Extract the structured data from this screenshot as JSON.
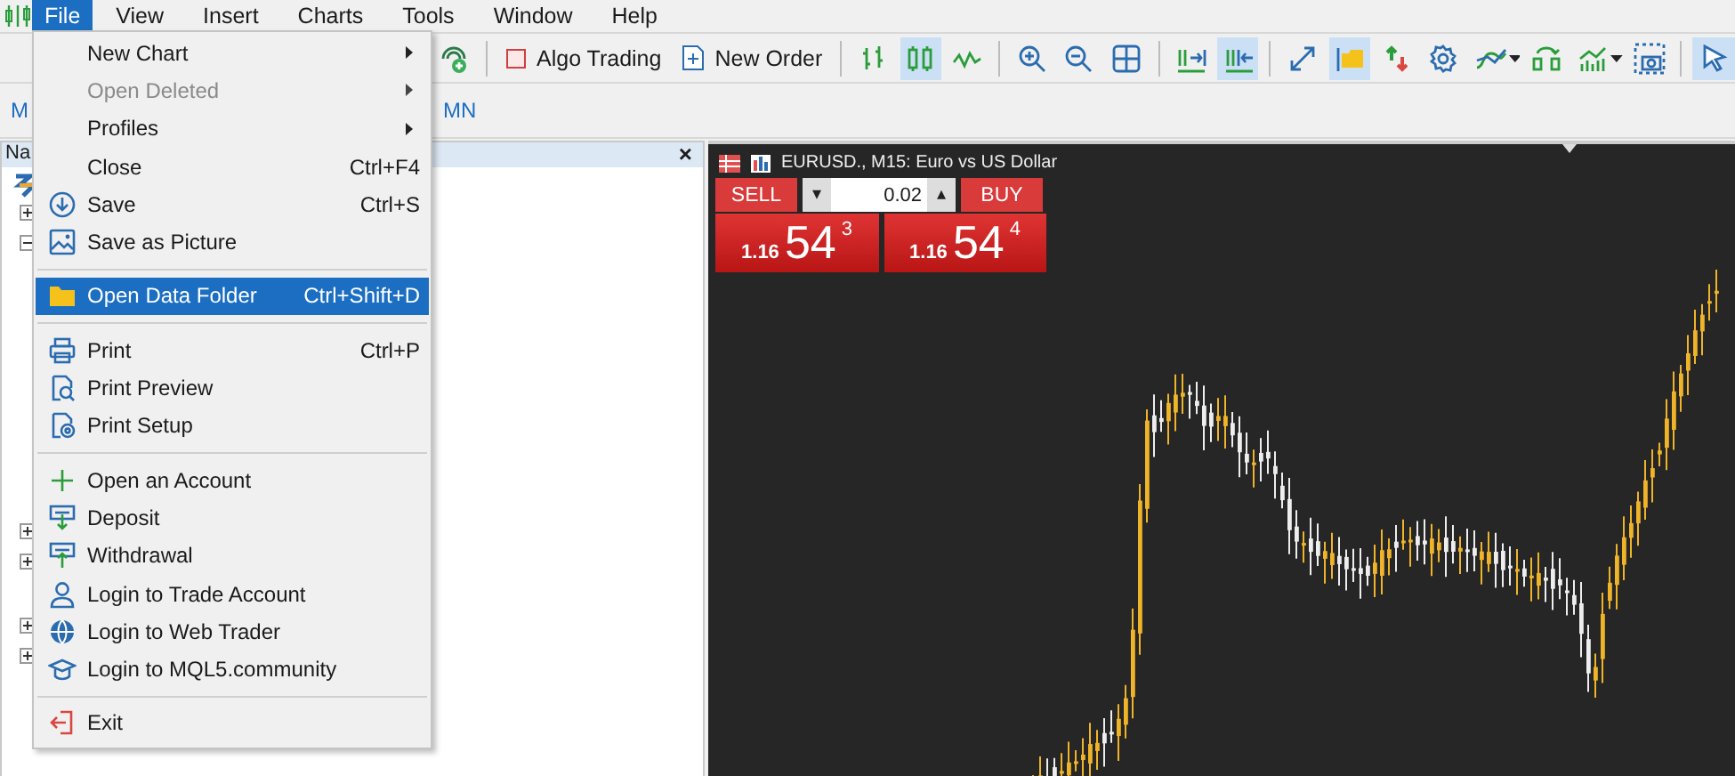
{
  "menubar": [
    {
      "label": "File",
      "selected": true
    },
    {
      "label": "View",
      "selected": false
    },
    {
      "label": "Insert",
      "selected": false
    },
    {
      "label": "Charts",
      "selected": false
    },
    {
      "label": "Tools",
      "selected": false
    },
    {
      "label": "Window",
      "selected": false
    },
    {
      "label": "Help",
      "selected": false
    }
  ],
  "toolbar": [
    {
      "kind": "signal",
      "pressed": false
    },
    {
      "kind": "sep"
    },
    {
      "kind": "algo",
      "label": "Algo Trading",
      "pressed": false
    },
    {
      "kind": "order",
      "label": "New Order",
      "pressed": false
    },
    {
      "kind": "sep"
    },
    {
      "kind": "bars",
      "pressed": false
    },
    {
      "kind": "candles",
      "pressed": true
    },
    {
      "kind": "line",
      "pressed": false
    },
    {
      "kind": "sep"
    },
    {
      "kind": "zoomin",
      "pressed": false
    },
    {
      "kind": "zoomout",
      "pressed": false
    },
    {
      "kind": "grid",
      "pressed": false
    },
    {
      "kind": "sep"
    },
    {
      "kind": "shift",
      "pressed": false
    },
    {
      "kind": "autoscroll",
      "pressed": true
    },
    {
      "kind": "sep"
    },
    {
      "kind": "fullscreen",
      "pressed": false
    },
    {
      "kind": "folder",
      "pressed": true
    },
    {
      "kind": "trade",
      "pressed": false
    },
    {
      "kind": "gear",
      "pressed": false
    },
    {
      "kind": "indicator",
      "pressed": false
    },
    {
      "kind": "caret"
    },
    {
      "kind": "cycle",
      "pressed": false
    },
    {
      "kind": "chart",
      "pressed": false
    },
    {
      "kind": "caret"
    },
    {
      "kind": "camera",
      "pressed": false
    },
    {
      "kind": "sep"
    },
    {
      "kind": "cursor",
      "pressed": true
    }
  ],
  "timeframes": [
    {
      "label": "M"
    },
    {
      "label": "MN"
    }
  ],
  "navigator": {
    "title": "Na",
    "close": "×",
    "nodes": [
      {
        "expanded": false
      },
      {
        "expanded": true
      },
      {
        "expanded": false
      },
      {
        "expanded": false
      },
      {
        "expanded": false
      },
      {
        "expanded": false
      }
    ]
  },
  "file_menu": [
    {
      "kind": "plain",
      "label": "New Chart",
      "submenu": true,
      "disabled": false,
      "selected": false
    },
    {
      "kind": "plain",
      "label": "Open Deleted",
      "submenu": true,
      "disabled": true,
      "selected": false
    },
    {
      "kind": "plain",
      "label": "Profiles",
      "submenu": true,
      "disabled": false,
      "selected": false
    },
    {
      "kind": "plain",
      "label": "Close",
      "shortcut": "Ctrl+F4",
      "disabled": false,
      "selected": false
    },
    {
      "kind": "save",
      "label": "Save",
      "shortcut": "Ctrl+S",
      "disabled": false,
      "selected": false
    },
    {
      "kind": "picture",
      "label": "Save as Picture",
      "disabled": false,
      "selected": false
    },
    {
      "kind": "separator"
    },
    {
      "kind": "folder",
      "label": "Open Data Folder",
      "shortcut": "Ctrl+Shift+D",
      "disabled": false,
      "selected": true
    },
    {
      "kind": "separator"
    },
    {
      "kind": "print",
      "label": "Print",
      "shortcut": "Ctrl+P",
      "disabled": false,
      "selected": false
    },
    {
      "kind": "preview",
      "label": "Print Preview",
      "disabled": false,
      "selected": false
    },
    {
      "kind": "setup",
      "label": "Print Setup",
      "disabled": false,
      "selected": false
    },
    {
      "kind": "separator"
    },
    {
      "kind": "plus",
      "label": "Open an Account",
      "disabled": false,
      "selected": false
    },
    {
      "kind": "deposit",
      "label": "Deposit",
      "disabled": false,
      "selected": false
    },
    {
      "kind": "withdraw",
      "label": "Withdrawal",
      "disabled": false,
      "selected": false
    },
    {
      "kind": "user",
      "label": "Login to Trade Account",
      "disabled": false,
      "selected": false
    },
    {
      "kind": "globe",
      "label": "Login to Web Trader",
      "disabled": false,
      "selected": false
    },
    {
      "kind": "cap",
      "label": "Login to MQL5.community",
      "disabled": false,
      "selected": false
    },
    {
      "kind": "separator"
    },
    {
      "kind": "exit",
      "label": "Exit",
      "disabled": false,
      "selected": false
    }
  ],
  "chart": {
    "title": "EURUSD., M15:  Euro vs US Dollar",
    "trade_panel": {
      "sell_label": "SELL",
      "buy_label": "BUY",
      "volume": "0.02",
      "down": "▾",
      "up": "▴",
      "sell_price": {
        "head": "1.16",
        "big": "54",
        "tail": "3"
      },
      "buy_price": {
        "head": "1.16",
        "big": "54",
        "tail": "4"
      }
    }
  }
}
